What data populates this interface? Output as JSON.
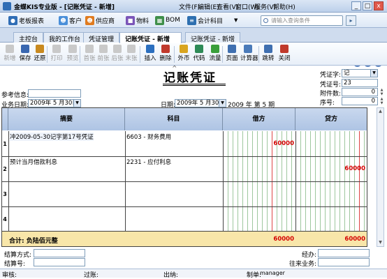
{
  "titlebar": {
    "title": "金蝶KIS专业版 - [记账凭证 - 新增]",
    "menus": [
      "文件(F)",
      "编辑(E)",
      "查看(V)",
      "窗口(W)",
      "服务(V)",
      "帮助(H)"
    ],
    "win_buttons": [
      "_",
      "□",
      "x"
    ]
  },
  "quickbar": {
    "items": [
      {
        "label": "老板报表",
        "icon": "boss-report-icon",
        "color": "#2f6db5"
      },
      {
        "label": "客户",
        "icon": "customer-icon",
        "color": "#4a8fd9"
      },
      {
        "label": "供应商",
        "icon": "supplier-icon",
        "color": "#e07b1f"
      },
      {
        "label": "物料",
        "icon": "material-icon",
        "color": "#7b55b8"
      },
      {
        "label": "BOM",
        "icon": "bom-icon",
        "color": "#3f8f4a"
      },
      {
        "label": "会计科目",
        "icon": "account-subject-icon",
        "color": "#2d6fb0"
      }
    ],
    "search_placeholder": "请输入查询条件"
  },
  "tabs": [
    {
      "label": "主控台",
      "active": false
    },
    {
      "label": "我的工作台",
      "active": false
    },
    {
      "label": "凭证管理",
      "active": false
    },
    {
      "label": "记账凭证 - 新增",
      "active": true
    },
    {
      "label": "记账凭证 - 新增",
      "active": false
    }
  ],
  "toolbar": {
    "buttons": [
      {
        "label": "新增",
        "enabled": false,
        "icon": "new-doc-icon",
        "color": "#9a9a9a"
      },
      {
        "label": "保存",
        "enabled": true,
        "icon": "save-icon",
        "color": "#3967b0"
      },
      {
        "label": "还原",
        "enabled": true,
        "icon": "restore-icon",
        "color": "#c98a1f"
      },
      {
        "label": "打印",
        "enabled": false,
        "icon": "print-icon",
        "color": "#9a9a9a"
      },
      {
        "label": "预览",
        "enabled": false,
        "icon": "preview-icon",
        "color": "#9a9a9a"
      },
      {
        "label": "首张",
        "enabled": false,
        "icon": "first-icon",
        "color": "#9a9a9a"
      },
      {
        "label": "前张",
        "enabled": false,
        "icon": "prev-icon",
        "color": "#9a9a9a"
      },
      {
        "label": "后张",
        "enabled": false,
        "icon": "next-icon",
        "color": "#9a9a9a"
      },
      {
        "label": "末张",
        "enabled": false,
        "icon": "last-icon",
        "color": "#9a9a9a"
      },
      {
        "label": "插入",
        "enabled": true,
        "icon": "insert-icon",
        "color": "#2b6fbf"
      },
      {
        "label": "删除",
        "enabled": true,
        "icon": "delete-icon",
        "color": "#c0392b"
      },
      {
        "label": "外币",
        "enabled": true,
        "icon": "currency-icon",
        "color": "#d9a520"
      },
      {
        "label": "代码",
        "enabled": true,
        "icon": "code-icon",
        "color": "#2e8b57"
      },
      {
        "label": "流量",
        "enabled": true,
        "icon": "cashflow-icon",
        "color": "#3a9f3a"
      },
      {
        "label": "页面",
        "enabled": true,
        "icon": "page-icon",
        "color": "#3f6fb0"
      },
      {
        "label": "计算器",
        "enabled": true,
        "icon": "calculator-icon",
        "color": "#4b7bb9"
      },
      {
        "label": "跳转",
        "enabled": true,
        "icon": "jump-icon",
        "color": "#3f6fb0"
      },
      {
        "label": "关闭",
        "enabled": true,
        "icon": "close-icon",
        "color": "#c0392b"
      }
    ]
  },
  "voucher": {
    "title": "记账凭证",
    "ref_label": "参考信息:",
    "ref_value": "",
    "biz_date_label": "业务日期:",
    "biz_date": "2009年 5 月30日",
    "date_label": "日期:",
    "date": "2009年 5 月30日",
    "period_text": "2009 年 第 5 期",
    "word_label": "凭证字:",
    "word": "记",
    "number_label": "凭证号:",
    "number": "23",
    "attach_label": "附件数:",
    "attach": "0",
    "seq_label": "序号:",
    "seq": "0"
  },
  "grid": {
    "headers": [
      "摘要",
      "科目",
      "借方",
      "贷方"
    ],
    "rows": [
      {
        "no": "1",
        "summary": "冲2009-05-30记字第17号凭证",
        "account": "6603 - 财务费用",
        "debit": "60000",
        "credit": ""
      },
      {
        "no": "2",
        "summary": "预计当月借款利息",
        "account": "2231 - 应付利息",
        "debit": "",
        "credit": "60000"
      },
      {
        "no": "3",
        "summary": "",
        "account": "",
        "debit": "",
        "credit": ""
      },
      {
        "no": "4",
        "summary": "",
        "account": "",
        "debit": "",
        "credit": ""
      }
    ],
    "total_label": "合计: 负陆佰元整",
    "total_debit": "60000",
    "total_credit": "60000"
  },
  "bottom": {
    "settle_method_label": "结算方式:",
    "settle_no_label": "结算号:",
    "handler_label": "经办:",
    "contact_label": "往来业务:"
  },
  "status": {
    "audit_label": "审核:",
    "post_label": "过账:",
    "cashier_label": "出纳:",
    "maker_label": "制单:",
    "maker": "manager"
  }
}
